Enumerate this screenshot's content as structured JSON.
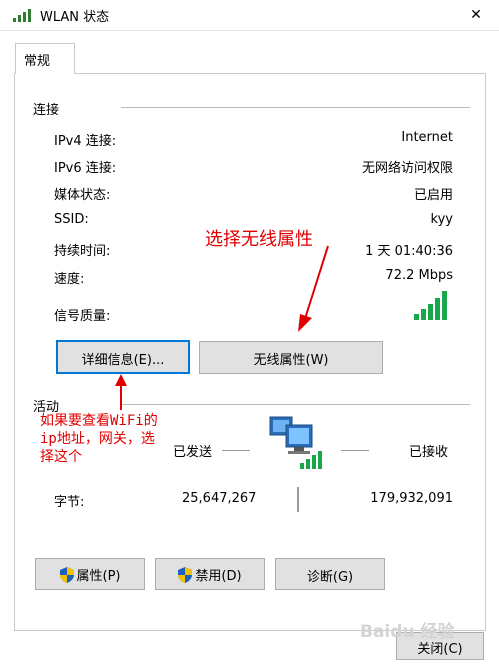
{
  "window": {
    "title": "WLAN 状态",
    "close_glyph": "✕"
  },
  "tabs": [
    {
      "label": "常规"
    }
  ],
  "connection": {
    "section_label": "连接",
    "rows": [
      {
        "label": "IPv4 连接:",
        "value": "Internet"
      },
      {
        "label": "IPv6 连接:",
        "value": "无网络访问权限"
      },
      {
        "label": "媒体状态:",
        "value": "已启用"
      },
      {
        "label": "SSID:",
        "value": "kyy"
      },
      {
        "label": "持续时间:",
        "value": "1 天 01:40:36"
      },
      {
        "label": "速度:",
        "value": "72.2 Mbps"
      }
    ],
    "signal_label": "信号质量:",
    "signal_bars": 5,
    "buttons": {
      "details": "详细信息(E)...",
      "wireless_props": "无线属性(W)"
    }
  },
  "activity": {
    "section_label": "活动",
    "sent_label": "已发送",
    "received_label": "已接收",
    "bytes_label": "字节:",
    "bytes_sent": "25,647,267",
    "bytes_received": "179,932,091"
  },
  "bottom_buttons": {
    "properties": "属性(P)",
    "disable": "禁用(D)",
    "diagnose": "诊断(G)"
  },
  "footer": {
    "close": "关闭(C)"
  },
  "annotations": {
    "wireless": "选择无线属性",
    "details": [
      "如果要查看WiFi的",
      "ip地址，网关，选",
      "择这个"
    ],
    "color": "#e00000"
  },
  "watermark": "Baidu 经验"
}
